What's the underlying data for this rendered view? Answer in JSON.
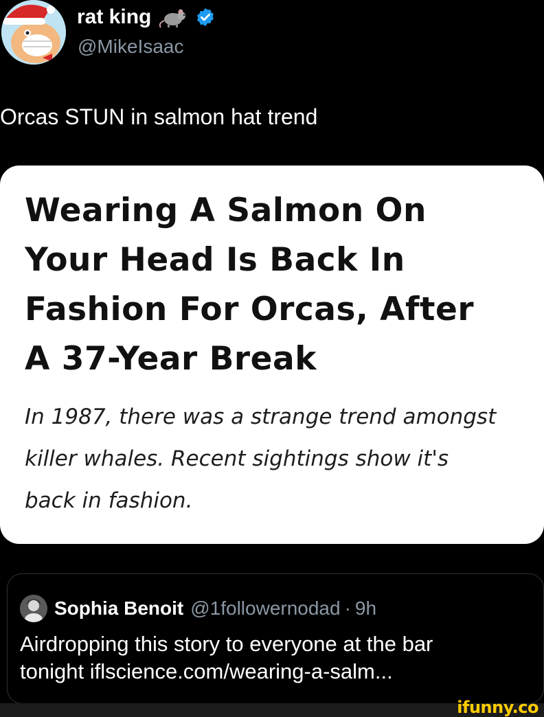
{
  "author": {
    "display_name": "rat king",
    "handle": "@MikeIsaac",
    "verified": true,
    "badge_icon": "verified-badge-icon",
    "emoji_icon": "rat-icon",
    "badge_color": "#1d9bf0"
  },
  "tweet": {
    "text": "Orcas STUN in salmon hat trend"
  },
  "article": {
    "title": "Wearing A Salmon On\nYour Head Is Back In\nFashion For Orcas, After\nA 37-Year Break",
    "summary": "In 1987, there was a strange trend amongst\nkiller whales. Recent sightings show it's\nback in fashion."
  },
  "quote": {
    "name": "Sophia Benoit",
    "handle": "@1followernodad",
    "separator": "·",
    "time": "9h",
    "text": "Airdropping this story to everyone at the bar\ntonight iflscience.com/wearing-a-salm..."
  },
  "watermark": {
    "text": "ifunny.co",
    "color": "#ffcc00"
  }
}
